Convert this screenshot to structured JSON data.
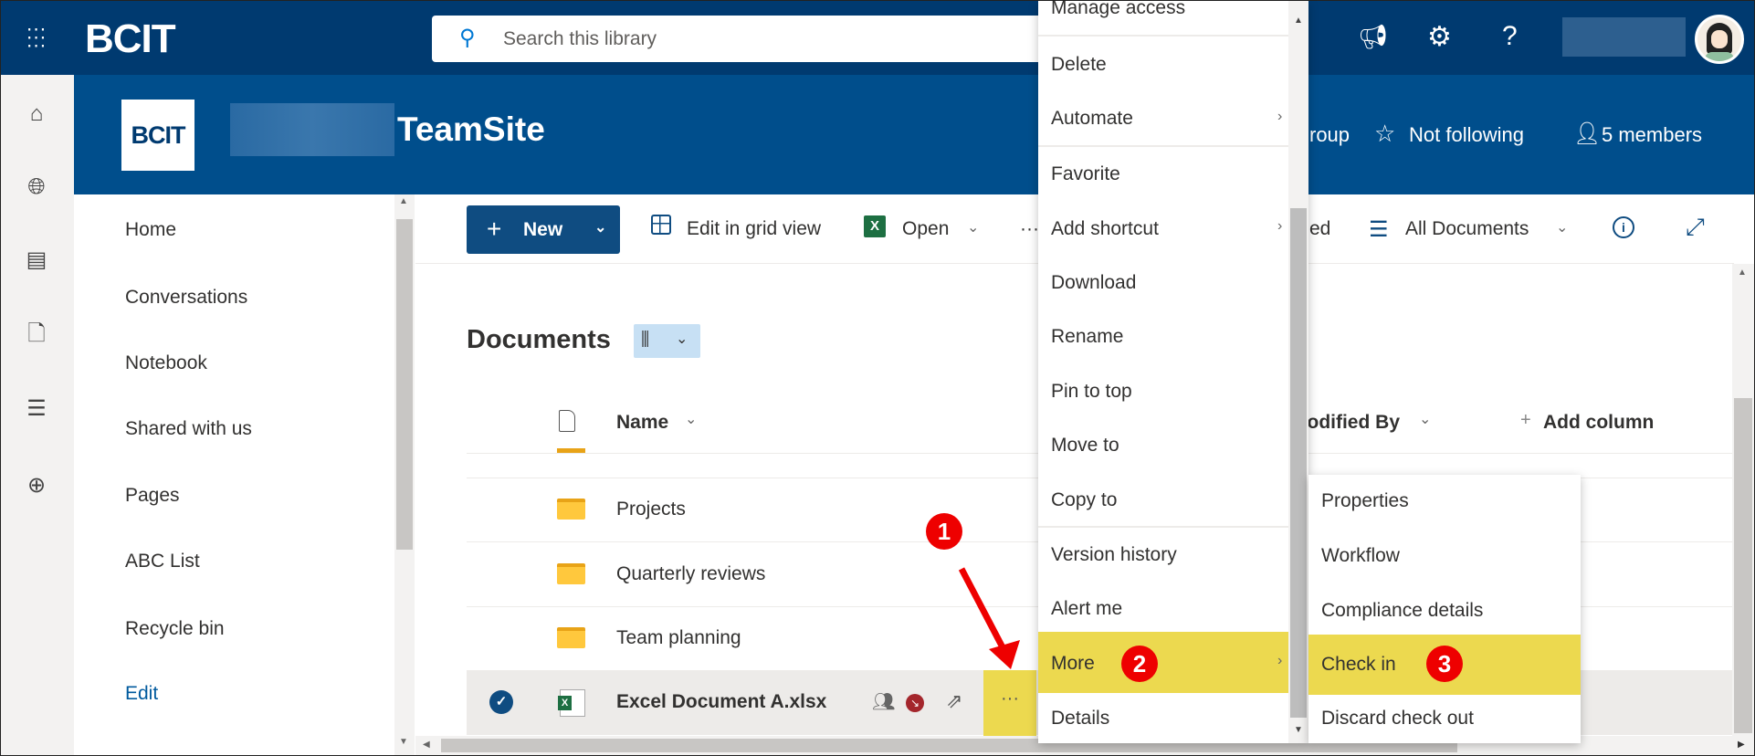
{
  "topbar": {
    "logo": "BCIT",
    "search_placeholder": "Search this library"
  },
  "site": {
    "logo": "BCIT",
    "title": "TeamSite",
    "group_partial": "roup",
    "follow": "Not following",
    "members": "5 members"
  },
  "nav": {
    "items": [
      "Home",
      "Conversations",
      "Notebook",
      "Shared with us",
      "Pages",
      "ABC List",
      "Recycle bin",
      "Edit"
    ]
  },
  "commandbar": {
    "new": "New",
    "edit_grid": "Edit in grid view",
    "open": "Open",
    "more": "···",
    "partial": "ed",
    "view": "All Documents"
  },
  "library": {
    "title": "Documents",
    "columns": {
      "name": "Name",
      "modified_by": "Modified By",
      "add": "Add column"
    },
    "rows": [
      {
        "name": "Projects",
        "type": "folder"
      },
      {
        "name": "Quarterly reviews",
        "type": "folder"
      },
      {
        "name": "Team planning",
        "type": "folder"
      },
      {
        "name": "Excel Document A.xlsx",
        "type": "excel",
        "selected": true
      }
    ]
  },
  "context_menu": {
    "items": [
      "Manage access",
      "Delete",
      "Automate",
      "Favorite",
      "Add shortcut",
      "Download",
      "Rename",
      "Pin to top",
      "Move to",
      "Copy to",
      "Version history",
      "Alert me",
      "More",
      "Details"
    ]
  },
  "submenu": {
    "items": [
      "Properties",
      "Workflow",
      "Compliance details",
      "Check in",
      "Discard check out"
    ]
  },
  "annotations": {
    "step1": "1",
    "step2": "2",
    "step3": "3"
  },
  "colors": {
    "topbar": "#003a70",
    "site_header": "#004e8c",
    "highlight": "#ecd94f",
    "badge": "#e00000",
    "link": "#005a9e"
  }
}
